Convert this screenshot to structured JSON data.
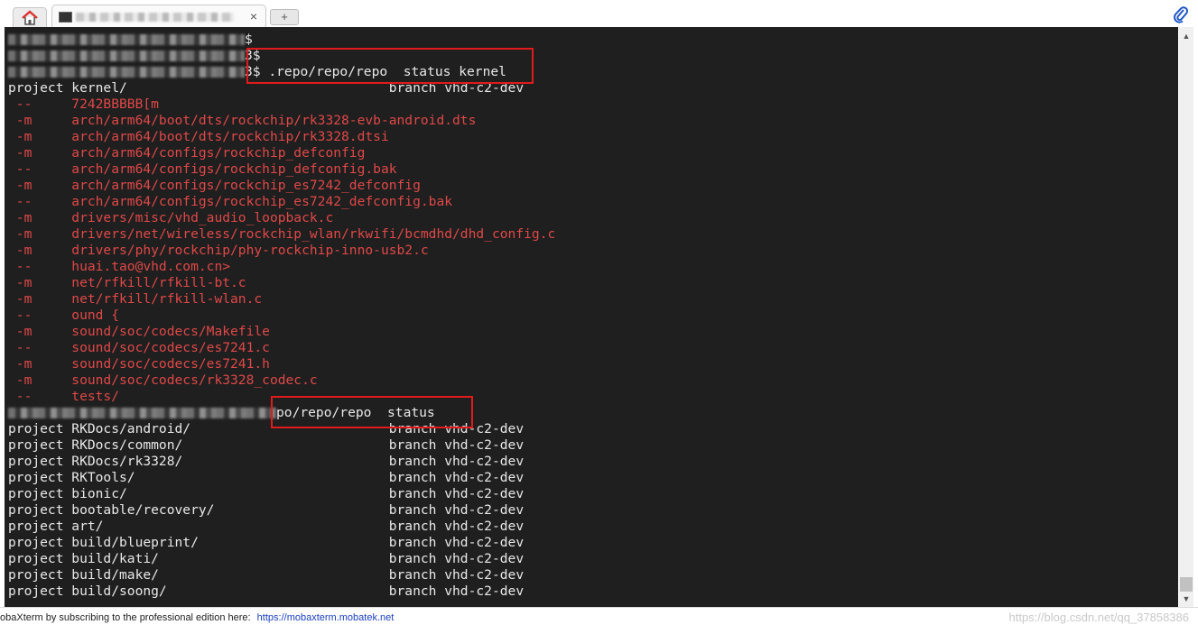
{
  "tabs": {
    "close": "×",
    "new": "+"
  },
  "terminal": {
    "lines": [
      {
        "pre": "",
        "redacted": 262,
        "text": "$",
        "color": "white"
      },
      {
        "pre": "",
        "redacted": 262,
        "text": "3$",
        "color": "white"
      },
      {
        "pre": "",
        "redacted": 262,
        "text": "3$ .repo/repo/repo  status kernel",
        "color": "white"
      },
      {
        "text": "project kernel/                                 branch vhd-c2-dev",
        "color": "white"
      },
      {
        "text": " --     7242BBBBB[m",
        "color": "red"
      },
      {
        "text": " -m     arch/arm64/boot/dts/rockchip/rk3328-evb-android.dts",
        "color": "red"
      },
      {
        "text": " -m     arch/arm64/boot/dts/rockchip/rk3328.dtsi",
        "color": "red"
      },
      {
        "text": " -m     arch/arm64/configs/rockchip_defconfig",
        "color": "red"
      },
      {
        "text": " --     arch/arm64/configs/rockchip_defconfig.bak",
        "color": "red"
      },
      {
        "text": " -m     arch/arm64/configs/rockchip_es7242_defconfig",
        "color": "red"
      },
      {
        "text": " --     arch/arm64/configs/rockchip_es7242_defconfig.bak",
        "color": "red"
      },
      {
        "text": " -m     drivers/misc/vhd_audio_loopback.c",
        "color": "red"
      },
      {
        "text": " -m     drivers/net/wireless/rockchip_wlan/rkwifi/bcmdhd/dhd_config.c",
        "color": "red"
      },
      {
        "text": " -m     drivers/phy/rockchip/phy-rockchip-inno-usb2.c",
        "color": "red"
      },
      {
        "text": " --     huai.tao@vhd.com.cn>",
        "color": "red"
      },
      {
        "text": " -m     net/rfkill/rfkill-bt.c",
        "color": "red"
      },
      {
        "text": " -m     net/rfkill/rfkill-wlan.c",
        "color": "red"
      },
      {
        "text": " --     ound {",
        "color": "red"
      },
      {
        "text": " -m     sound/soc/codecs/Makefile",
        "color": "red"
      },
      {
        "text": " --     sound/soc/codecs/es7241.c",
        "color": "red"
      },
      {
        "text": " -m     sound/soc/codecs/es7241.h",
        "color": "red"
      },
      {
        "text": " -m     sound/soc/codecs/rk3328_codec.c",
        "color": "red"
      },
      {
        "text": " --     tests/",
        "color": "red"
      },
      {
        "pre": "",
        "redacted": 297,
        "text": "po/repo/repo  status",
        "color": "white"
      },
      {
        "text": "project RKDocs/android/                         branch vhd-c2-dev",
        "color": "white"
      },
      {
        "text": "project RKDocs/common/                          branch vhd-c2-dev",
        "color": "white"
      },
      {
        "text": "project RKDocs/rk3328/                          branch vhd-c2-dev",
        "color": "white"
      },
      {
        "text": "project RKTools/                                branch vhd-c2-dev",
        "color": "white"
      },
      {
        "text": "project bionic/                                 branch vhd-c2-dev",
        "color": "white"
      },
      {
        "text": "project bootable/recovery/                      branch vhd-c2-dev",
        "color": "white"
      },
      {
        "text": "project art/                                    branch vhd-c2-dev",
        "color": "white"
      },
      {
        "text": "project build/blueprint/                        branch vhd-c2-dev",
        "color": "white"
      },
      {
        "text": "project build/kati/                             branch vhd-c2-dev",
        "color": "white"
      },
      {
        "text": "project build/make/                             branch vhd-c2-dev",
        "color": "white"
      },
      {
        "text": "project build/soong/                            branch vhd-c2-dev",
        "color": "white"
      }
    ]
  },
  "statusbar": {
    "message": "obaXterm by subscribing to the professional edition here:",
    "link": "https://mobaxterm.mobatek.net",
    "watermark": "https://blog.csdn.net/qq_37858386"
  },
  "colors": {
    "red": "#e04848",
    "white": "#e8e8e8",
    "highlight": "#e11b1b"
  },
  "icons": [
    "home-icon",
    "terminal-icon",
    "close-icon",
    "new-tab-icon",
    "paperclip-icon",
    "arrow-up-icon",
    "arrow-down-icon"
  ]
}
